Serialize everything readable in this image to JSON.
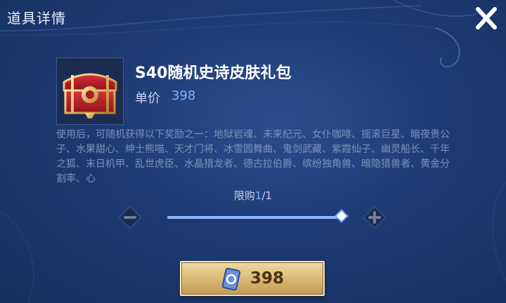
{
  "window": {
    "title": "道具详情"
  },
  "item": {
    "name": "S40随机史诗皮肤礼包",
    "price_label": "单价",
    "price_value": "398",
    "icon": "red-gold-treasure-chest"
  },
  "description": "使用后，可随机获得以下奖励之一：地狱岩魂、未来纪元、女仆咖啡、摇滚巨星、暗夜贵公子、水果甜心、绅士熊喵、天才门将、冰雪圆舞曲、鬼剑武藏、紫霞仙子、幽灵船长、千年之狐、末日机甲、乱世虎臣、水晶猎龙者、德古拉伯爵、缤纷独角兽、暗隐猎兽者、黄金分割率、心",
  "purchase_limit": {
    "label": "限购",
    "current": "1",
    "total": "/1"
  },
  "quantity_slider": {
    "fraction": 1.0
  },
  "buy_button": {
    "price": "398",
    "icon": "coupon-icon"
  },
  "colors": {
    "accent": "#7fb2ff",
    "button_gold": "#d9b773",
    "background": "#1f3a72"
  }
}
